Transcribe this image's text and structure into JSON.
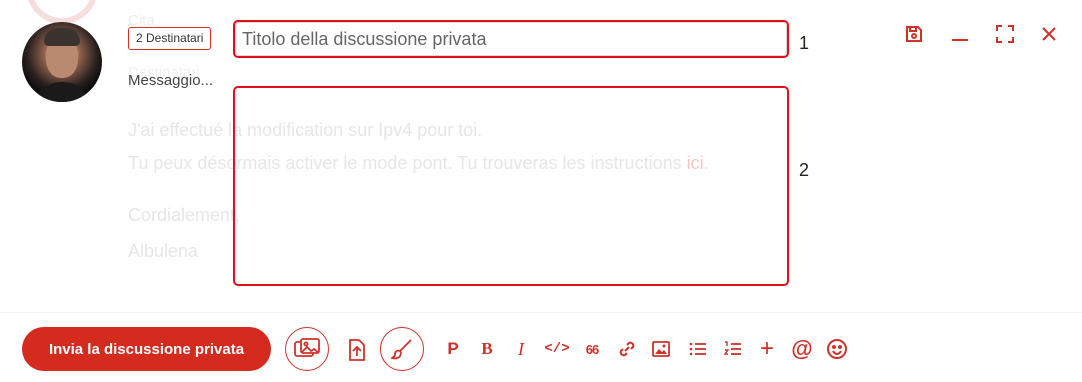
{
  "background": {
    "cita_label": "Cita",
    "dest_label": "Destinatari",
    "lines": [
      "J'ai effectué la modification sur Ipv4 pour toi.",
      "Tu peux désormais activer le mode pont. Tu trouveras les instructions ",
      "Cordialement,",
      "Albulena"
    ],
    "link_text": "ici",
    "link_suffix": "."
  },
  "composer": {
    "recipients_badge": "2 Destinatari",
    "title_placeholder": "Titolo della discussione privata",
    "message_label": "Messaggio...",
    "send_label": "Invia la discussione privata"
  },
  "window_controls": [
    "save-icon",
    "minimize-icon",
    "fullscreen-icon",
    "close-icon"
  ],
  "toolbar": {
    "paragraph": "P",
    "bold": "B",
    "italic": "I",
    "code": "</>",
    "quote": "66",
    "plus": "+",
    "at": "@"
  },
  "annotations": {
    "label_1": "1",
    "label_2": "2"
  },
  "colors": {
    "accent": "#d42b1e",
    "annotation": "#e3101b"
  }
}
